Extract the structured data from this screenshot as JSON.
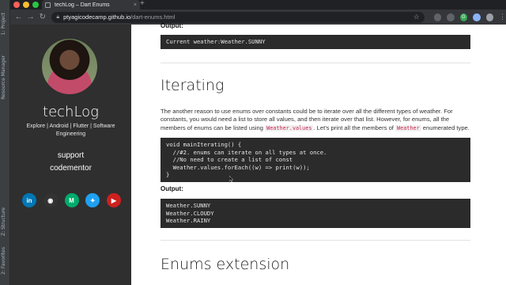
{
  "ide": {
    "tabs": [
      "1: Project",
      "Resource Manager",
      "Z: Structure",
      "2: Favorites"
    ]
  },
  "browser": {
    "tab_title": "techLog – Dart Enums",
    "tab_close": "×",
    "new_tab": "+",
    "url_host": "ptyagicodecamp.github.io",
    "url_path": "/dart-enums.html",
    "nav": {
      "back": "←",
      "forward": "→",
      "reload": "↻",
      "star": "☆",
      "menu": "⋮"
    },
    "ext_labels": [
      "",
      "",
      "G",
      "",
      ""
    ]
  },
  "sidebar": {
    "brand": "techLog",
    "tagline": "Explore | Android | Flutter | Software Engineering",
    "links": [
      "support",
      "codementor"
    ],
    "socials": [
      {
        "icon": "linkedin-icon",
        "glyph": "in",
        "color": "#0077b5"
      },
      {
        "icon": "github-icon",
        "glyph": "◉",
        "color": "#333333"
      },
      {
        "icon": "medium-icon",
        "glyph": "M",
        "color": "#00ab6c"
      },
      {
        "icon": "twitter-icon",
        "glyph": "✦",
        "color": "#1da1f2"
      },
      {
        "icon": "youtube-icon",
        "glyph": "▶",
        "color": "#cd201f"
      }
    ]
  },
  "content": {
    "output_label_top": "Output:",
    "output_code_top": "Current weather:Weather.SUNNY",
    "heading_iterating": "Iterating",
    "paragraph": {
      "part1": "The another reason to use enums over constants could be to iterate over all the different types of weather. For constants, you would need a list to store all values, and then iterate over that list. However, for enums, all the members of enums can be listed using ",
      "code1": "Weather.values",
      "part2": ". Let's print all the members of ",
      "code2": "Weather",
      "part3": " enumerated type."
    },
    "code_iterating": "void mainIterating() {\n  //#2. enums can iterate on all types at once.\n  //No need to create a list of const\n  Weather.values.forEach((w) => print(w));\n}",
    "output_label": "Output:",
    "output_code": "Weather.SUNNY\nWeather.CLOUDY\nWeather.RAINY",
    "heading_enums_extension": "Enums extension"
  },
  "colors": {
    "traffic_red": "#ff5f57",
    "traffic_yellow": "#febc2e",
    "traffic_green": "#28c840"
  }
}
